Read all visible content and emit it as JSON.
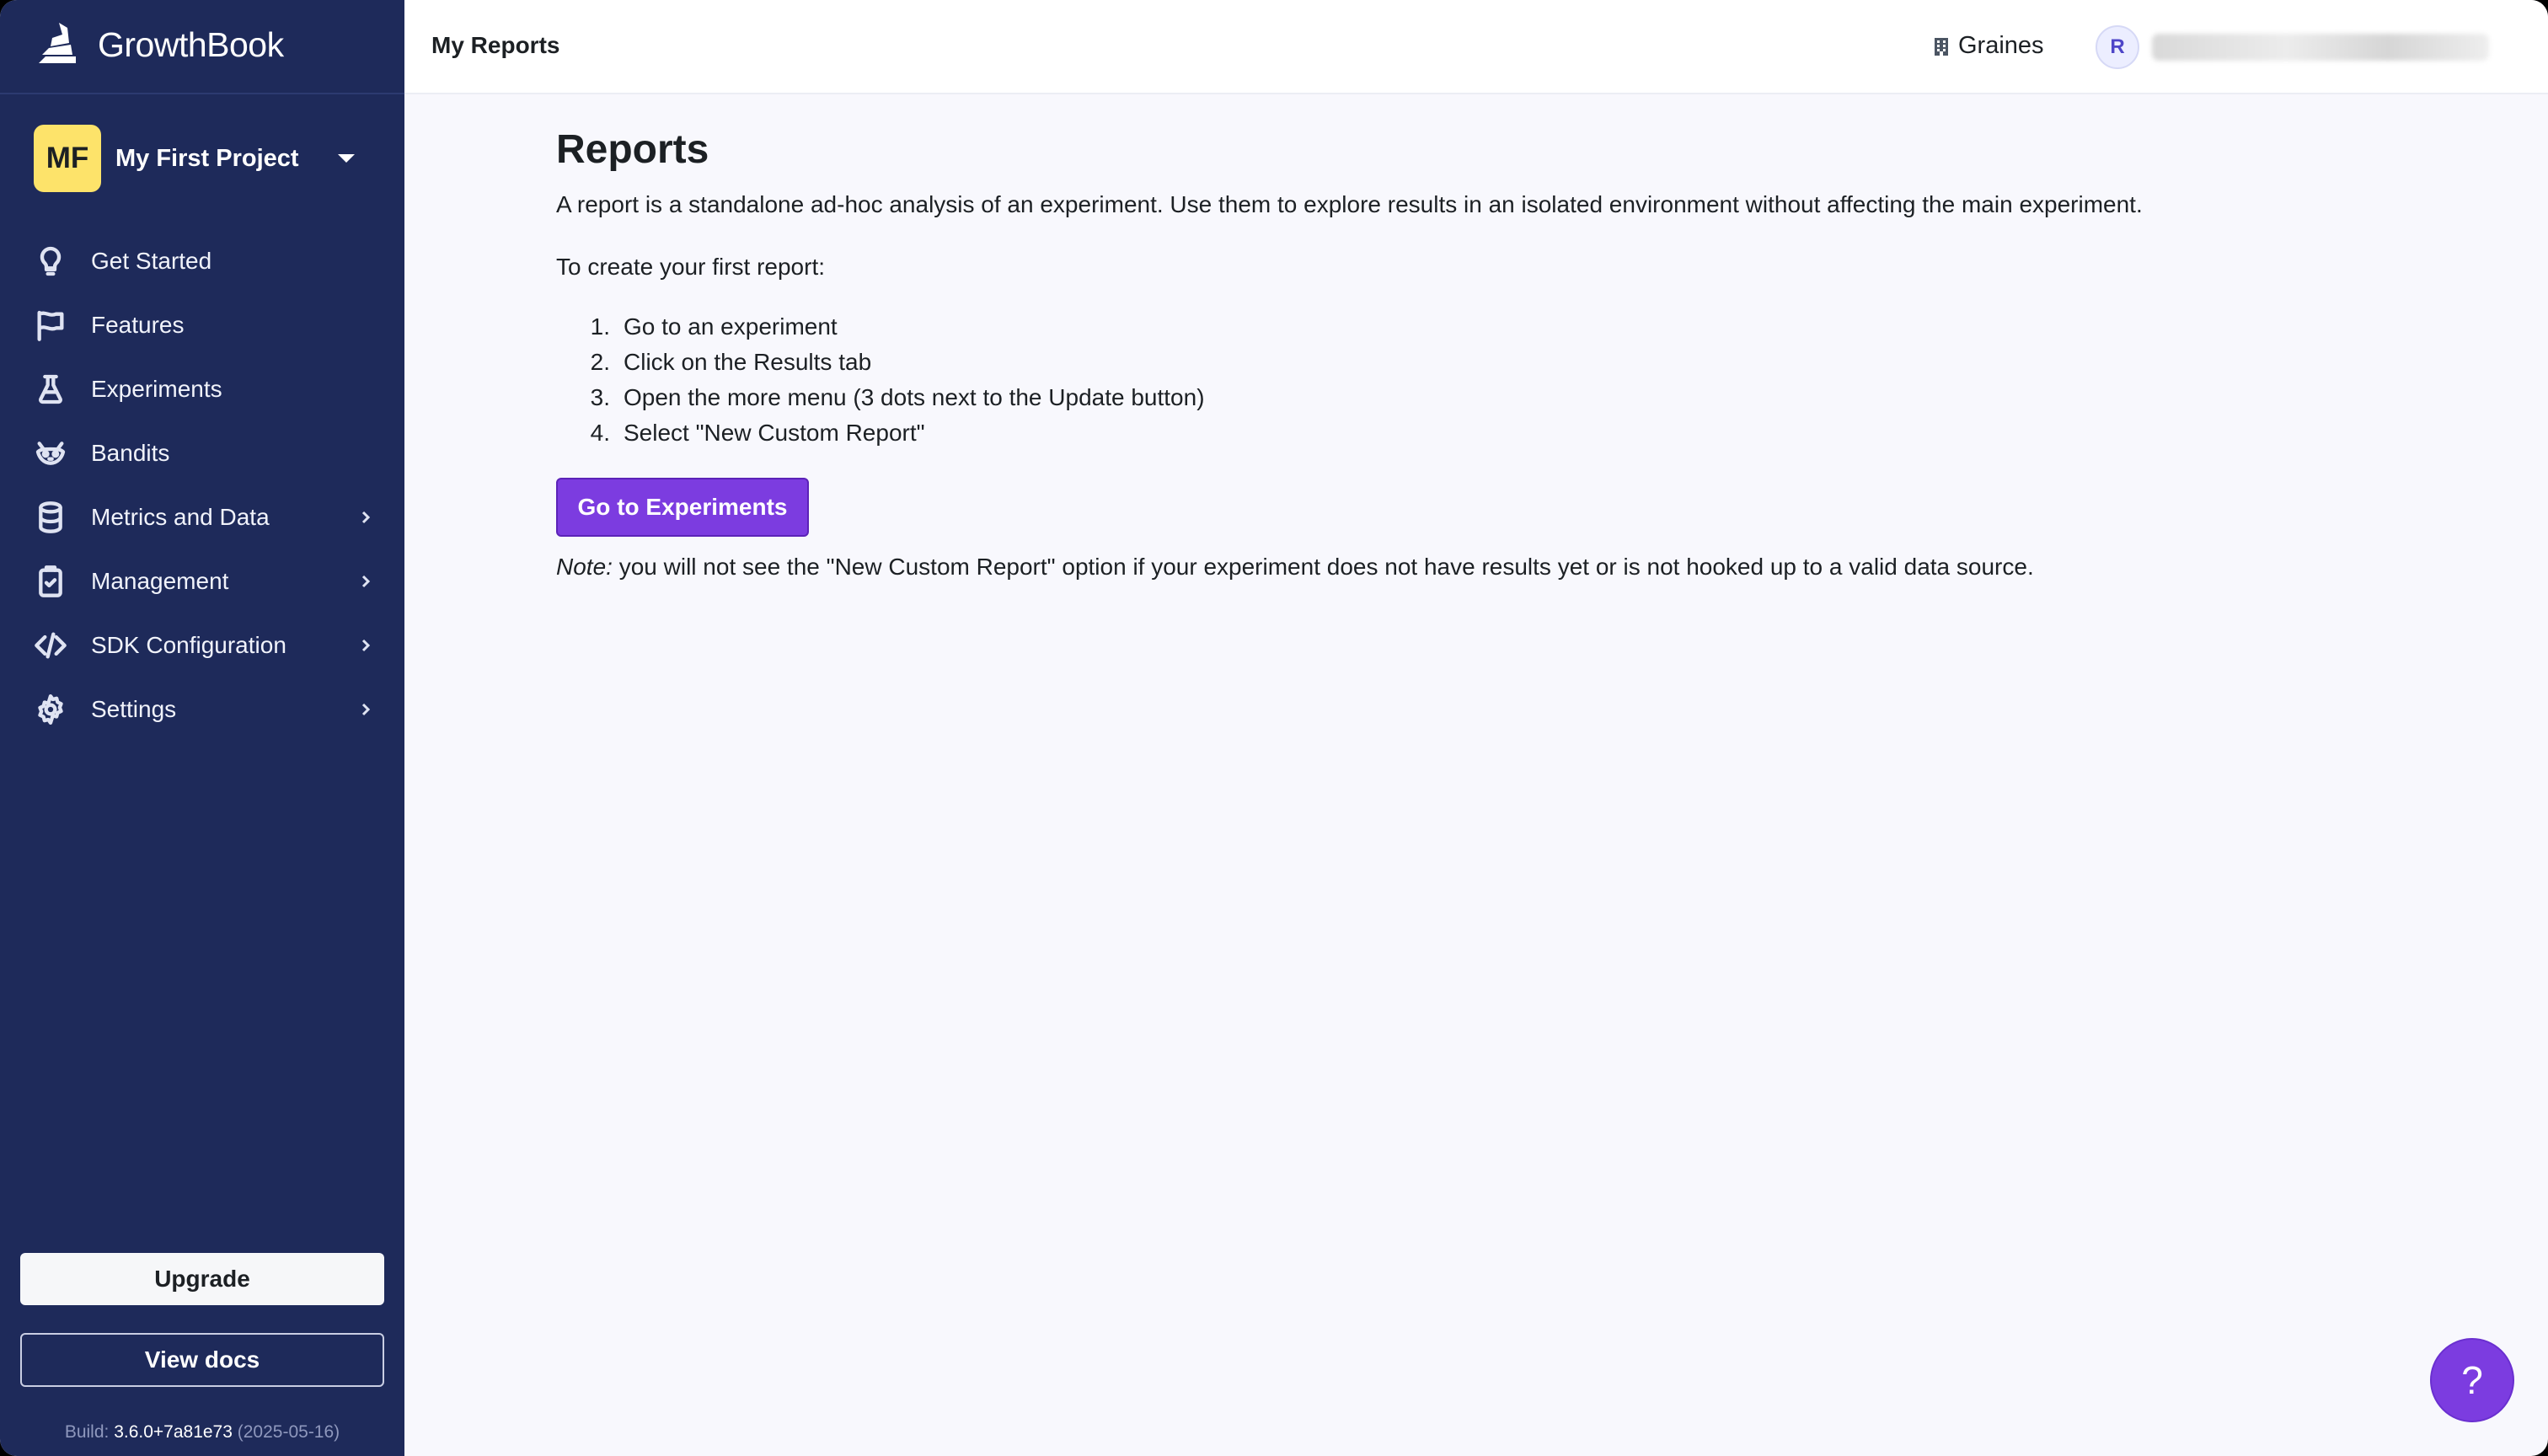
{
  "app": {
    "name": "GrowthBook"
  },
  "project": {
    "initials": "MF",
    "name": "My First Project"
  },
  "sidebar": {
    "items": [
      {
        "label": "Get Started",
        "icon": "lightbulb-icon",
        "expandable": false
      },
      {
        "label": "Features",
        "icon": "flag-icon",
        "expandable": false
      },
      {
        "label": "Experiments",
        "icon": "flask-icon",
        "expandable": false
      },
      {
        "label": "Bandits",
        "icon": "raccoon-icon",
        "expandable": false
      },
      {
        "label": "Metrics and Data",
        "icon": "database-icon",
        "expandable": true
      },
      {
        "label": "Management",
        "icon": "clipboard-icon",
        "expandable": true
      },
      {
        "label": "SDK Configuration",
        "icon": "code-icon",
        "expandable": true
      },
      {
        "label": "Settings",
        "icon": "gear-icon",
        "expandable": true
      }
    ],
    "upgrade_label": "Upgrade",
    "docs_label": "View docs",
    "build_prefix": "Build: ",
    "build_version": "3.6.0+7a81e73",
    "build_date": " (2025-05-16)"
  },
  "topbar": {
    "title": "My Reports",
    "org_name": "Graines",
    "user_initial": "R"
  },
  "main": {
    "title": "Reports",
    "intro": "A report is a standalone ad-hoc analysis of an experiment. Use them to explore results in an isolated environment without affecting the main experiment.",
    "steps_label": "To create your first report:",
    "steps": [
      {
        "num": "1.",
        "text": "Go to an experiment"
      },
      {
        "num": "2.",
        "text": "Click on the Results tab"
      },
      {
        "num": "3.",
        "text": "Open the more menu (3 dots next to the Update button)"
      },
      {
        "num": "4.",
        "text": "Select \"New Custom Report\""
      }
    ],
    "cta_label": "Go to Experiments",
    "note_prefix": "Note:",
    "note_text": " you will not see the \"New Custom Report\" option if your experiment does not have results yet or is not hooked up to a valid data source."
  },
  "help": {
    "label": "?"
  },
  "colors": {
    "sidebar_bg": "#1e2a5a",
    "accent": "#7c3ce0",
    "page_bg": "#f8f8fd",
    "project_avatar": "#fde36a"
  }
}
